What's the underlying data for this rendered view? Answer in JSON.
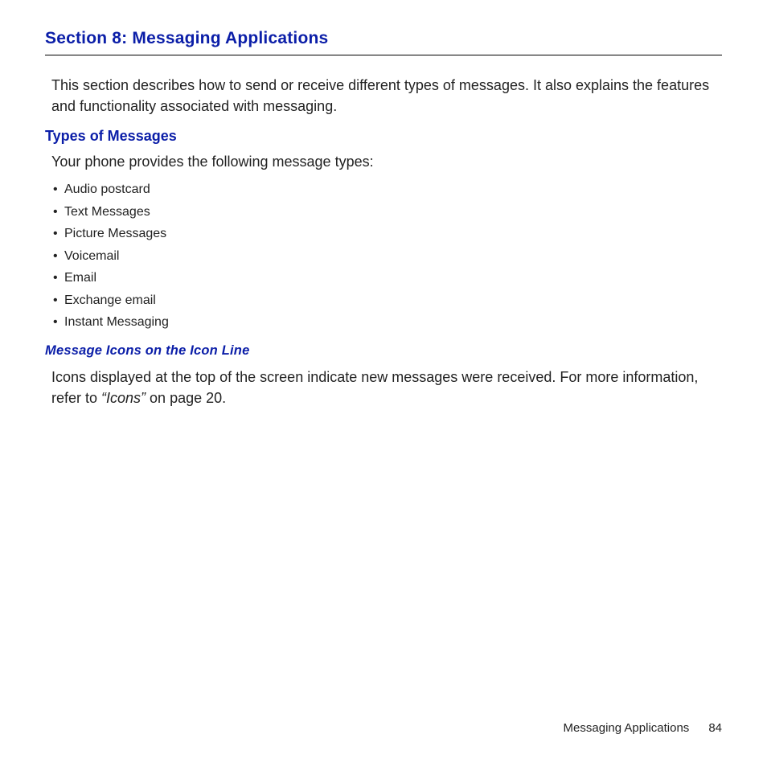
{
  "section": {
    "title": "Section 8: Messaging Applications",
    "intro": "This section describes how to send or receive different types of messages. It also explains the features and functionality associated with messaging."
  },
  "types": {
    "heading": "Types of Messages",
    "intro": "Your phone provides the following message types:",
    "items": [
      "Audio postcard",
      "Text Messages",
      "Picture Messages",
      "Voicemail",
      "Email",
      "Exchange email",
      "Instant Messaging"
    ]
  },
  "icons": {
    "heading": "Message Icons on the Icon Line",
    "text_part1": "Icons displayed at the top of the screen indicate new messages were received. For more information, refer to ",
    "ref": "“Icons”",
    "text_part2": "  on page 20."
  },
  "footer": {
    "label": "Messaging Applications",
    "page": "84"
  }
}
